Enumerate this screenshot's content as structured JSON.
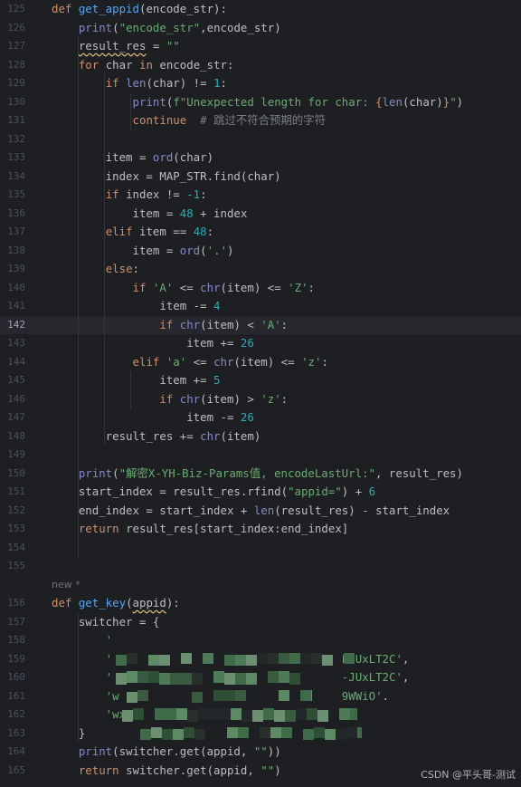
{
  "lines": [
    {
      "num": "125",
      "tokens": [
        [
          "kw",
          "def "
        ],
        [
          "fn",
          "get_appid"
        ],
        [
          "p",
          "(encode_str):"
        ]
      ]
    },
    {
      "num": "126",
      "tokens": [
        [
          "p",
          "    "
        ],
        [
          "bi",
          "print"
        ],
        [
          "p",
          "("
        ],
        [
          "str",
          "\"encode_str\""
        ],
        [
          "p",
          ",encode_str)"
        ]
      ]
    },
    {
      "num": "127",
      "tokens": [
        [
          "p",
          "    "
        ],
        [
          "sq",
          "result_res"
        ],
        [
          "p",
          " = "
        ],
        [
          "str",
          "\"\""
        ]
      ]
    },
    {
      "num": "128",
      "tokens": [
        [
          "p",
          "    "
        ],
        [
          "kw",
          "for "
        ],
        [
          "p",
          "char "
        ],
        [
          "kw",
          "in "
        ],
        [
          "p",
          "encode_str:"
        ]
      ]
    },
    {
      "num": "129",
      "tokens": [
        [
          "p",
          "        "
        ],
        [
          "kw",
          "if "
        ],
        [
          "bi",
          "len"
        ],
        [
          "p",
          "(char) != "
        ],
        [
          "num",
          "1"
        ],
        [
          "p",
          ":"
        ]
      ]
    },
    {
      "num": "130",
      "tokens": [
        [
          "p",
          "            "
        ],
        [
          "bi",
          "print"
        ],
        [
          "p",
          "("
        ],
        [
          "str",
          "f\"Unexpected length for char: "
        ],
        [
          "fmt",
          "{"
        ],
        [
          "bi",
          "len"
        ],
        [
          "p",
          "(char)"
        ],
        [
          "fmt",
          "}"
        ],
        [
          "str",
          "\""
        ],
        [
          "p",
          ")"
        ]
      ]
    },
    {
      "num": "131",
      "tokens": [
        [
          "p",
          "            "
        ],
        [
          "kw",
          "continue"
        ],
        [
          "cmt",
          "  # 跳过不符合预期的字符"
        ]
      ]
    },
    {
      "num": "132",
      "tokens": []
    },
    {
      "num": "133",
      "tokens": [
        [
          "p",
          "        item = "
        ],
        [
          "bi",
          "ord"
        ],
        [
          "p",
          "(char)"
        ]
      ]
    },
    {
      "num": "134",
      "tokens": [
        [
          "p",
          "        index = MAP_STR.find(char)"
        ]
      ]
    },
    {
      "num": "135",
      "tokens": [
        [
          "p",
          "        "
        ],
        [
          "kw",
          "if "
        ],
        [
          "p",
          "index != "
        ],
        [
          "num",
          "-1"
        ],
        [
          "p",
          ":"
        ]
      ]
    },
    {
      "num": "136",
      "tokens": [
        [
          "p",
          "            item = "
        ],
        [
          "num",
          "48"
        ],
        [
          "p",
          " + index"
        ]
      ]
    },
    {
      "num": "137",
      "tokens": [
        [
          "p",
          "        "
        ],
        [
          "kw",
          "elif "
        ],
        [
          "p",
          "item == "
        ],
        [
          "num",
          "48"
        ],
        [
          "p",
          ":"
        ]
      ]
    },
    {
      "num": "138",
      "tokens": [
        [
          "p",
          "            item = "
        ],
        [
          "bi",
          "ord"
        ],
        [
          "p",
          "("
        ],
        [
          "str",
          "'.'"
        ],
        [
          "p",
          ")"
        ]
      ]
    },
    {
      "num": "139",
      "tokens": [
        [
          "p",
          "        "
        ],
        [
          "kw",
          "else"
        ],
        [
          "p",
          ":"
        ]
      ]
    },
    {
      "num": "140",
      "tokens": [
        [
          "p",
          "            "
        ],
        [
          "kw",
          "if "
        ],
        [
          "str",
          "'A'"
        ],
        [
          "p",
          " <= "
        ],
        [
          "bi",
          "chr"
        ],
        [
          "p",
          "(item) <= "
        ],
        [
          "str",
          "'Z'"
        ],
        [
          "p",
          ":"
        ]
      ]
    },
    {
      "num": "141",
      "tokens": [
        [
          "p",
          "                item -= "
        ],
        [
          "num",
          "4"
        ]
      ]
    },
    {
      "num": "142",
      "tokens": [
        [
          "p",
          "                "
        ],
        [
          "kw",
          "if "
        ],
        [
          "bi",
          "chr"
        ],
        [
          "p",
          "(item) < "
        ],
        [
          "str",
          "'A'"
        ],
        [
          "p",
          ":"
        ]
      ],
      "current": true
    },
    {
      "num": "143",
      "tokens": [
        [
          "p",
          "                    item += "
        ],
        [
          "num",
          "26"
        ]
      ]
    },
    {
      "num": "144",
      "tokens": [
        [
          "p",
          "            "
        ],
        [
          "kw",
          "elif "
        ],
        [
          "str",
          "'a'"
        ],
        [
          "p",
          " <= "
        ],
        [
          "bi",
          "chr"
        ],
        [
          "p",
          "(item) <= "
        ],
        [
          "str",
          "'z'"
        ],
        [
          "p",
          ":"
        ]
      ]
    },
    {
      "num": "145",
      "tokens": [
        [
          "p",
          "                item += "
        ],
        [
          "num",
          "5"
        ]
      ]
    },
    {
      "num": "146",
      "tokens": [
        [
          "p",
          "                "
        ],
        [
          "kw",
          "if "
        ],
        [
          "bi",
          "chr"
        ],
        [
          "p",
          "(item) > "
        ],
        [
          "str",
          "'z'"
        ],
        [
          "p",
          ":"
        ]
      ]
    },
    {
      "num": "147",
      "tokens": [
        [
          "p",
          "                    item -= "
        ],
        [
          "num",
          "26"
        ]
      ]
    },
    {
      "num": "148",
      "tokens": [
        [
          "p",
          "        result_res += "
        ],
        [
          "bi",
          "chr"
        ],
        [
          "p",
          "(item)"
        ]
      ]
    },
    {
      "num": "149",
      "tokens": []
    },
    {
      "num": "150",
      "tokens": [
        [
          "p",
          "    "
        ],
        [
          "bi",
          "print"
        ],
        [
          "p",
          "("
        ],
        [
          "str",
          "\"解密X-YH-Biz-Params值, encodeLastUrl:\""
        ],
        [
          "p",
          ", result_res)"
        ]
      ]
    },
    {
      "num": "151",
      "tokens": [
        [
          "p",
          "    start_index = result_res.rfind("
        ],
        [
          "str",
          "\"appid=\""
        ],
        [
          "p",
          ") + "
        ],
        [
          "num",
          "6"
        ]
      ]
    },
    {
      "num": "152",
      "tokens": [
        [
          "p",
          "    end_index = start_index + "
        ],
        [
          "bi",
          "len"
        ],
        [
          "p",
          "(result_res) - start_index"
        ]
      ]
    },
    {
      "num": "153",
      "tokens": [
        [
          "p",
          "    "
        ],
        [
          "kw",
          "return "
        ],
        [
          "p",
          "result_res[start_index:end_index]"
        ]
      ]
    },
    {
      "num": "154",
      "tokens": []
    },
    {
      "num": "155",
      "tokens": []
    },
    {
      "inlay": "new *"
    },
    {
      "num": "156",
      "tokens": [
        [
          "kw",
          "def "
        ],
        [
          "fn",
          "get_key"
        ],
        [
          "p",
          "("
        ],
        [
          "sq",
          "appid"
        ],
        [
          "p",
          "):"
        ]
      ]
    },
    {
      "num": "157",
      "tokens": [
        [
          "p",
          "    switcher = {"
        ]
      ]
    },
    {
      "num": "158",
      "tokens": [
        [
          "str",
          "        '"
        ]
      ]
    },
    {
      "num": "159",
      "tokens": [
        [
          "str",
          "        '"
        ],
        [
          "p",
          ""
        ],
        [
          "str",
          "                                  LJUxLT2C'"
        ],
        [
          "p",
          ","
        ]
      ]
    },
    {
      "num": "160",
      "tokens": [
        [
          "str",
          "        '"
        ],
        [
          "p",
          ""
        ],
        [
          "str",
          "                                  -JUxLT2C'"
        ],
        [
          "p",
          ","
        ]
      ]
    },
    {
      "num": "161",
      "tokens": [
        [
          "str",
          "        'w"
        ],
        [
          "str",
          "                                 9WWiO'"
        ],
        [
          "p",
          "."
        ]
      ]
    },
    {
      "num": "162",
      "tokens": [
        [
          "str",
          "        'wx8d"
        ]
      ]
    },
    {
      "num": "163",
      "tokens": [
        [
          "p",
          "    }"
        ]
      ]
    },
    {
      "num": "164",
      "tokens": [
        [
          "p",
          "    "
        ],
        [
          "bi",
          "print"
        ],
        [
          "p",
          "(switcher.get(appid, "
        ],
        [
          "str",
          "\"\""
        ],
        [
          "p",
          "))"
        ]
      ]
    },
    {
      "num": "165",
      "tokens": [
        [
          "p",
          "    "
        ],
        [
          "kw",
          "return "
        ],
        [
          "p",
          "switcher.get(appid, "
        ],
        [
          "str",
          "\"\""
        ],
        [
          "p",
          ")"
        ]
      ]
    }
  ],
  "watermark": "CSDN @平头哥-测试"
}
